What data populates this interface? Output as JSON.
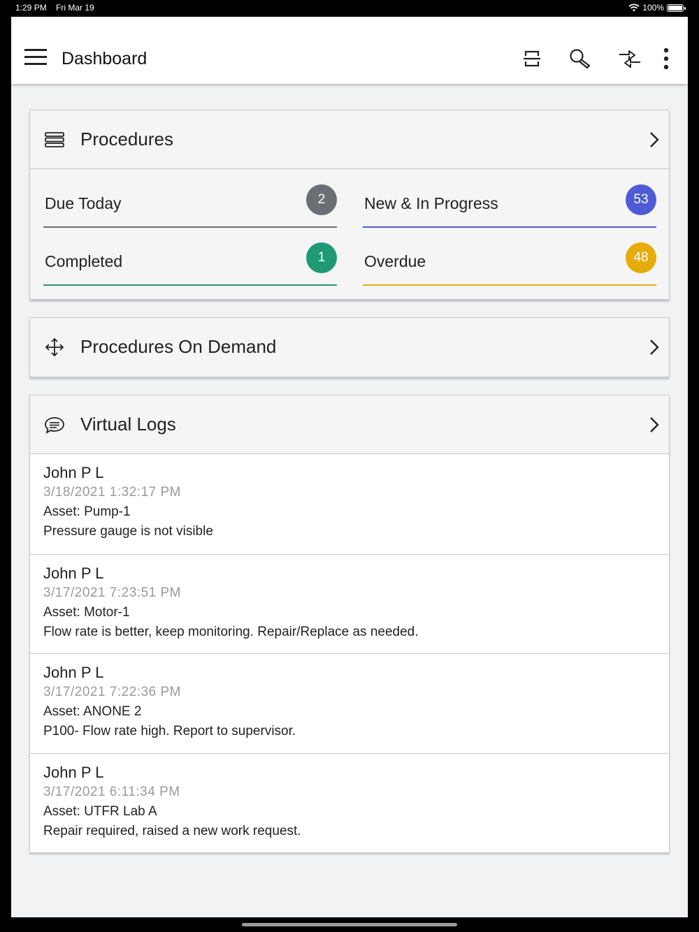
{
  "status": {
    "time": "1:29 PM",
    "date": "Fri Mar 19",
    "battery": "100%"
  },
  "app": {
    "title": "Dashboard"
  },
  "actions": [
    {
      "name": "scan-icon"
    },
    {
      "name": "search-icon"
    },
    {
      "name": "sync-icon"
    },
    {
      "name": "more-icon"
    }
  ],
  "procedures": {
    "title": "Procedures",
    "stats": [
      {
        "label": "Due Today",
        "count": "2",
        "color": "#6b6e72",
        "line": "#6b6e72"
      },
      {
        "label": "New & In Progress",
        "count": "53",
        "color": "#4f5bd5",
        "line": "#4f5bd5"
      },
      {
        "label": "Completed",
        "count": "1",
        "color": "#1f9a74",
        "line": "#1f9a74"
      },
      {
        "label": "Overdue",
        "count": "48",
        "color": "#e6ac0c",
        "line": "#e6ac0c"
      }
    ]
  },
  "on_demand": {
    "title": "Procedures On Demand"
  },
  "virtual_logs": {
    "title": "Virtual Logs",
    "items": [
      {
        "name": "John P L",
        "date": "3/18/2021 1:32:17 PM",
        "asset": "Asset: Pump-1",
        "note": "Pressure gauge is not visible"
      },
      {
        "name": "John P L",
        "date": "3/17/2021 7:23:51 PM",
        "asset": "Asset: Motor-1",
        "note": "Flow rate is better, keep monitoring. Repair/Replace as needed."
      },
      {
        "name": "John P L",
        "date": "3/17/2021 7:22:36 PM",
        "asset": "Asset: ANONE 2",
        "note": "P100- Flow rate high. Report to supervisor."
      },
      {
        "name": "John P L",
        "date": "3/17/2021 6:11:34 PM",
        "asset": "Asset: UTFR Lab A",
        "note": "Repair required, raised a new work request."
      }
    ]
  }
}
